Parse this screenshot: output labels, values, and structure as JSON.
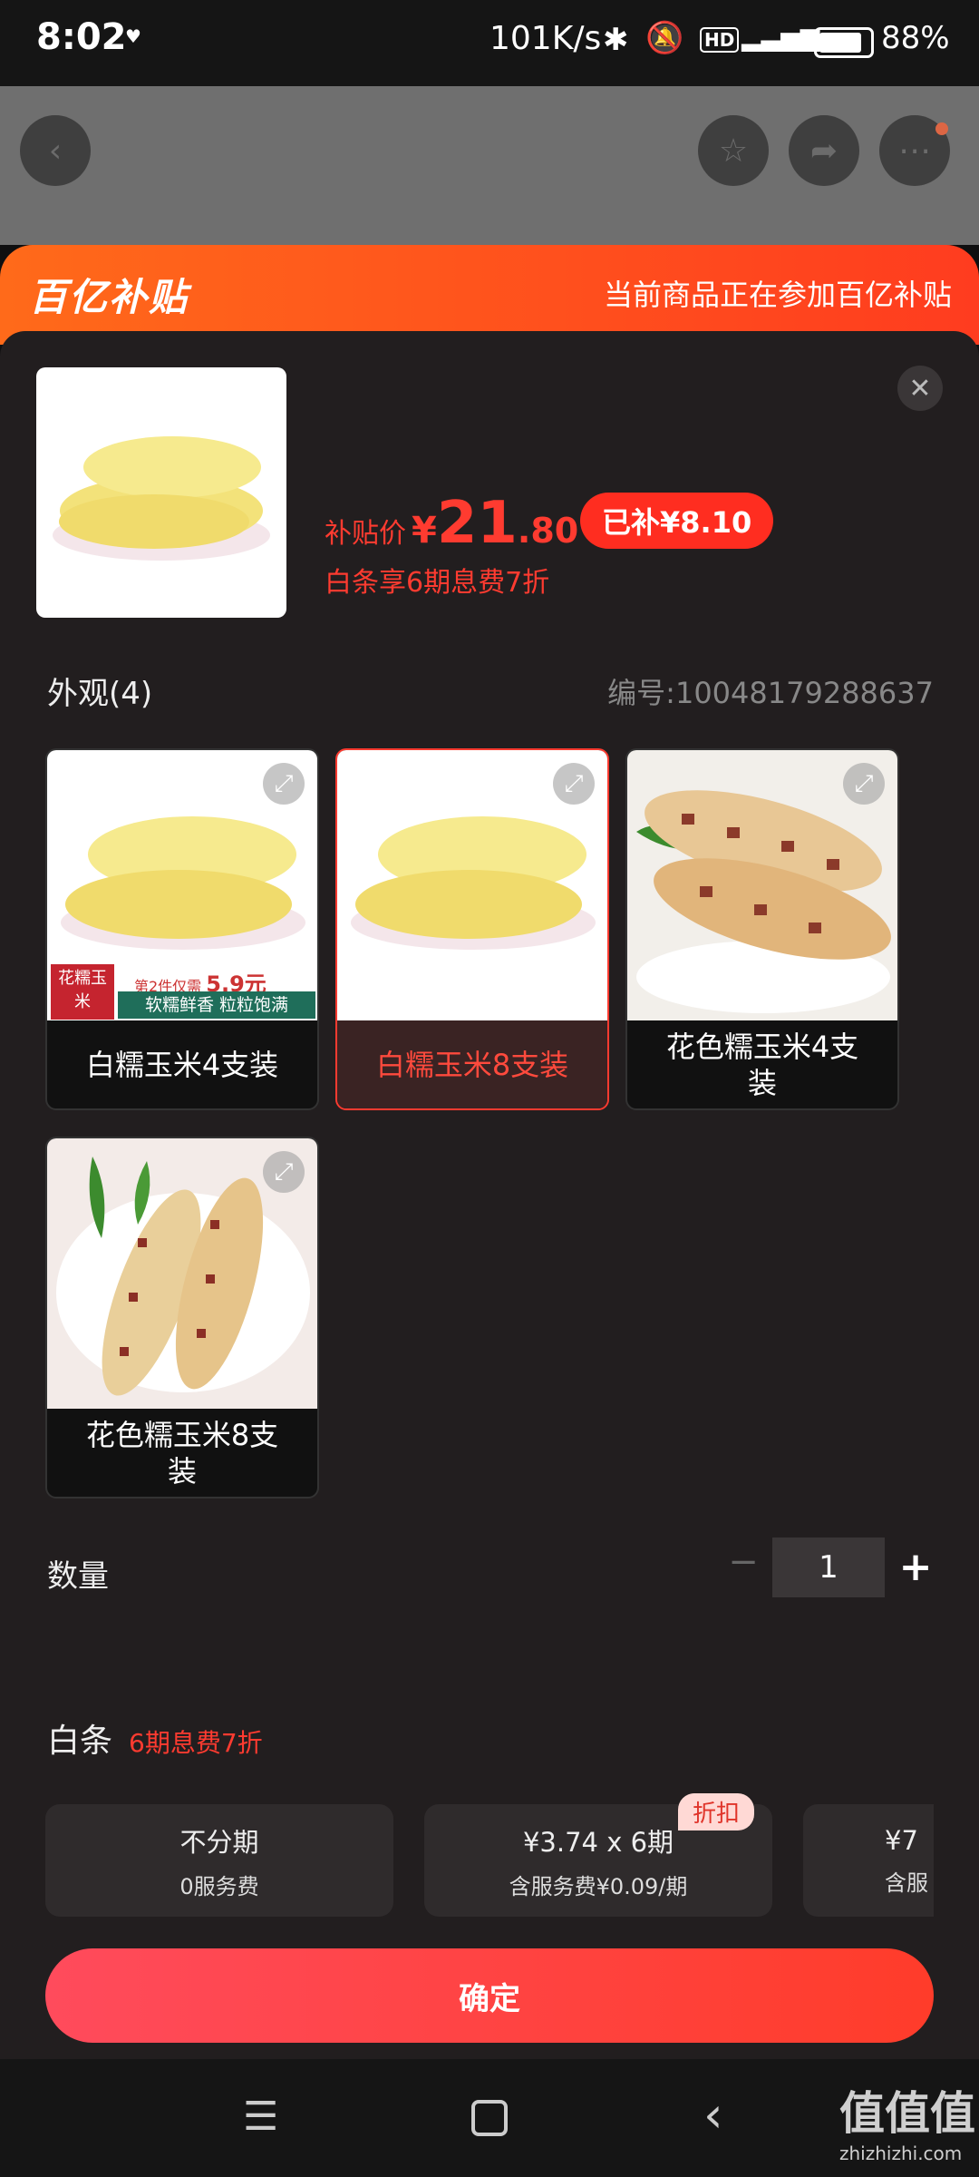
{
  "status_bar": {
    "time": "8:02",
    "network_speed": "101K/s",
    "battery": "88%"
  },
  "subsidy_banner": {
    "logo": "百亿补贴",
    "message": "当前商品正在参加百亿补贴"
  },
  "product": {
    "price_label": "补贴价",
    "currency": "¥",
    "price_int": "21",
    "price_dec": ".80",
    "subsidy_badge": "已补¥8.10",
    "installment_note": "白条享6期息费7折"
  },
  "appearance": {
    "title": "外观(4)",
    "sku_code": "编号:10048179288637",
    "options": [
      {
        "label": "白糯玉米4支装",
        "promo_tag": "花糯玉米",
        "promo_line1": "第2件仅需",
        "promo_price": "5.9元",
        "promo_line2": "软糯鲜香 粒粒饱满"
      },
      {
        "label": "白糯玉米8支装"
      },
      {
        "label": "花色糯玉米4支装"
      },
      {
        "label": "花色糯玉米8支装"
      }
    ]
  },
  "quantity": {
    "label": "数量",
    "value": "1",
    "minus": "−",
    "plus": "+"
  },
  "baitiao": {
    "title": "白条",
    "subtitle": "6期息费7折",
    "discount_tag": "折扣",
    "plans": [
      {
        "title": "不分期",
        "sub": "0服务费"
      },
      {
        "title": "¥3.74 x 6期",
        "sub": "含服务费¥0.09/期"
      },
      {
        "title": "¥7",
        "sub": "含服"
      }
    ]
  },
  "confirm_button": "确定",
  "watermark": {
    "line1": "值值值",
    "line2": "zhizhizhi.com"
  },
  "colors": {
    "accent": "#ff3b30",
    "sheet_bg": "#221e1f",
    "banner_start": "#ff6a1a",
    "banner_end": "#ff3c1f"
  }
}
